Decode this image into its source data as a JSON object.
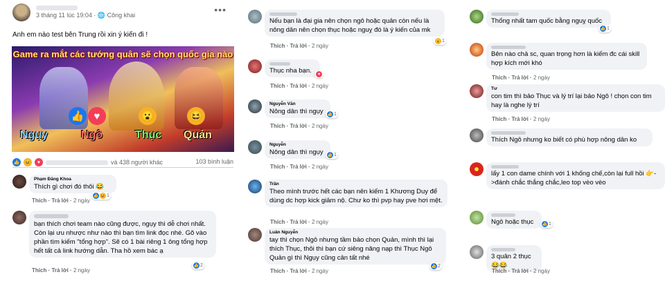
{
  "post": {
    "author_blur": "",
    "date": "3 tháng 11 lúc 19:04",
    "privacy": "Công khai",
    "text": "Anh em nào test bên Trung rồi xin ý kiến đi !",
    "banner_title": "Game ra mắt các tướng quân sẽ chọn quốc gia nào",
    "factions": [
      "Ngụy",
      "Ngô",
      "Thục",
      "Quản"
    ],
    "reactions_text": "và 438 người khác",
    "comment_count": "103 bình luận"
  },
  "actions": {
    "like": "Thích",
    "reply": "Trả lời"
  },
  "col1": [
    {
      "name": "Phạm Đăng Khoa",
      "text": "Thích gì chơi đó thôi 😂",
      "time": "2 ngày",
      "react": "1"
    },
    {
      "name": "",
      "text": "bạn thích chơi team nào cũng được, ngụy thì dễ chơi nhất. Còn lại ưu nhược như nào thì bạn tìm link đọc nhé. Gõ vào phần tìm kiếm \"tổng hợp\". Sẽ có 1 bài riêng 1 ông tổng hợp hết tất cả link hướng dẫn. Tha hồ xem bác ạ",
      "time": "2 ngày",
      "react": "2"
    }
  ],
  "col2": [
    {
      "name": "",
      "text": "Nếu bạn là đại gia nên chọn ngô hoặc quản còn nếu là nông dân nên chọn thục hoặc nguỵ đó là ý kiến của mk",
      "time": "2 ngày",
      "react": "1"
    },
    {
      "name": "",
      "text": "Thục nha bạn.",
      "time": "2 ngày",
      "react": ""
    },
    {
      "name": "Nguyễn Văn",
      "text": "Nông dân thì ngụy",
      "time": "2 ngày",
      "react": "1"
    },
    {
      "name": "Nguyễn",
      "text": "Nông dân thì ngụy",
      "time": "2 ngày",
      "react": "1"
    },
    {
      "name": "Trần",
      "text": "Theo mình trước hết các bạn nên kiếm 1 Khương Duy để dùng dc hợp kick giảm nộ. Chư ko thì pvp hay pve hơi mệt.",
      "time": "2 ngày",
      "react": ""
    },
    {
      "name": "Luân Nguyễn",
      "text": "tay thì chọn Ngô nhưng tầm bảo chọn Quản, mình thì lại thích Thục, thôi thì bạn cứ siêng năng nạp thì Thục Ngô Quản gì thì Ngụy cũng cân tất nhé",
      "time": "2 ngày",
      "react": "2"
    }
  ],
  "col3": [
    {
      "name": "",
      "text": "Thống nhất tam quốc bằng nguỵ quốc",
      "time": "2 ngày",
      "react": "1"
    },
    {
      "name": "",
      "text": "Bên nào chả sc, quan trọng hơn là kiếm đc cái skill hợp kích mới khó",
      "time": "2 ngày",
      "react": ""
    },
    {
      "name": "Tư",
      "text": "con tim thì bảo Thục và lý trí lại bảo Ngô ! chọn con tim hay là nghe lý trí",
      "time": "2 ngày",
      "react": ""
    },
    {
      "name": "",
      "text": "Thích Ngô nhưng ko biết có phù hợp nông dân ko",
      "time": "2 ngày",
      "react": ""
    },
    {
      "name": "",
      "text": "lấy 1 con dame chính với 1 khống chế,còn lại full hồi 👉->đánh chắc thắng chắc,leo top vèo vèo",
      "time": "2 ngày",
      "react": ""
    },
    {
      "name": "",
      "text": "Ngô hoặc thục",
      "time": "2 ngày",
      "react": "1"
    },
    {
      "name": "",
      "text": "3 quân 2 thục 😂😂",
      "time": "2 ngày",
      "react": ""
    }
  ]
}
